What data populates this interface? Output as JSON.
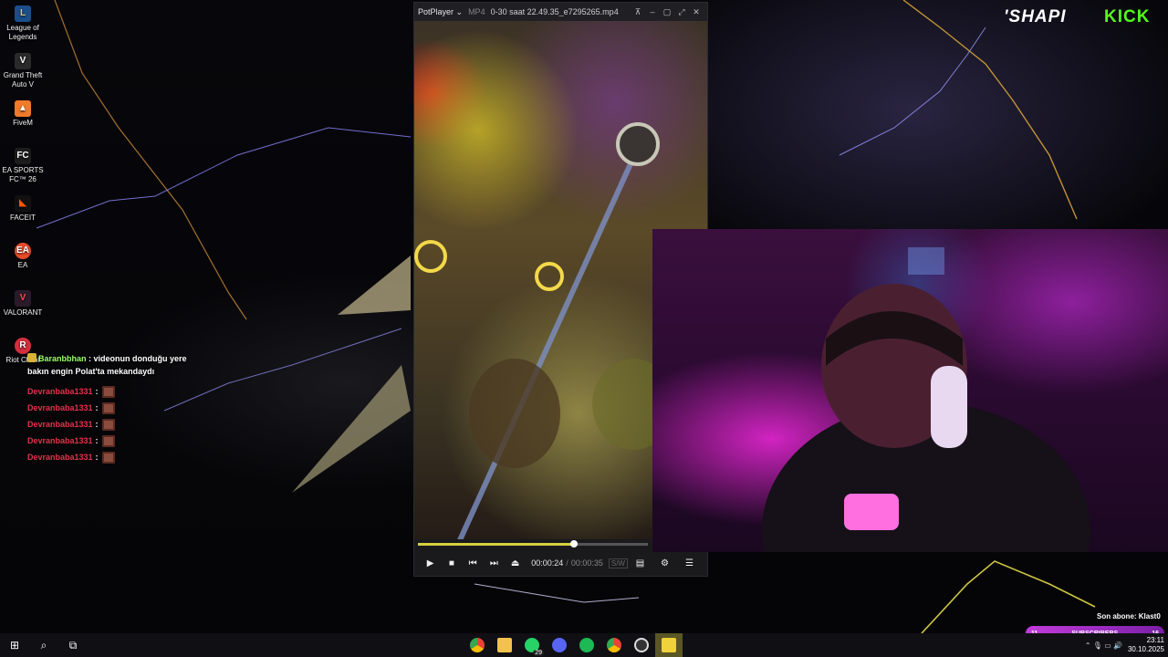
{
  "desktop": {
    "icons": [
      {
        "label": "League of Legends",
        "icon": "league-icon"
      },
      {
        "label": "Grand Theft Auto V",
        "icon": "gta-icon"
      },
      {
        "label": "FiveM",
        "icon": "fivem-icon"
      },
      {
        "label": "EA SPORTS FC™ 26",
        "icon": "ea-fc-icon"
      },
      {
        "label": "FACEIT",
        "icon": "faceit-icon"
      },
      {
        "label": "EA",
        "icon": "ea-icon"
      },
      {
        "label": "VALORANT",
        "icon": "valorant-icon"
      },
      {
        "label": "Riot Client",
        "icon": "riot-client-icon"
      }
    ]
  },
  "chat": {
    "first": {
      "user": "Baranbbhan",
      "text": ": videonun donduğu yere bakın engin Polat'ta mekandaydı"
    },
    "repeat_user": "Devranbaba1331",
    "repeat_sep": ":",
    "repeat_count": 5
  },
  "potplayer": {
    "app": "PotPlayer ⌄",
    "format": "MP4",
    "filename": "0-30 saat 22.49.35_e7295265.mp4",
    "time_current": "00:00:24",
    "time_sep": "/",
    "time_total": "00:00:35",
    "codec": "S/W",
    "progress": 0.68
  },
  "brand": {
    "shapi": "'SHAPI",
    "kick": "KICK"
  },
  "subs": {
    "last_sub": "Son abone: Klast0",
    "current": "11",
    "label": "SUBSCRIBERS",
    "goal": "16",
    "progress": 0.6875
  },
  "taskbar": {
    "whatsapp_badge": "29",
    "time": "23:11",
    "date": "30.10.2025"
  },
  "colors": {
    "kick_green": "#53fc18",
    "sub_purple": "#c23bdb",
    "seek_yellow": "#d6d040"
  }
}
